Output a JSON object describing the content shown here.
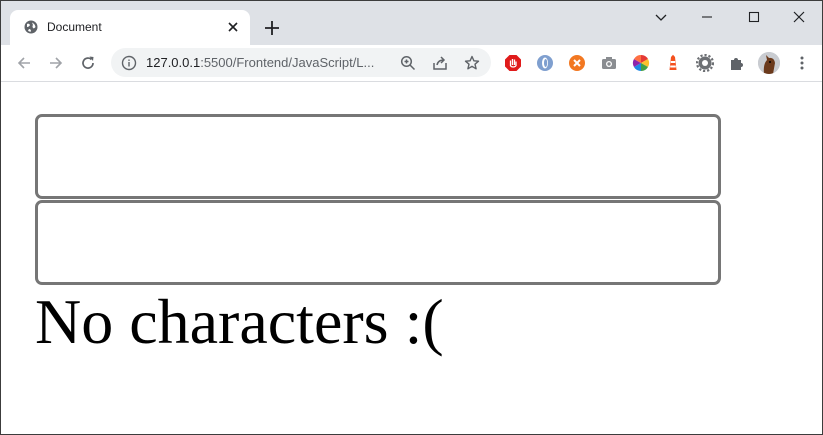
{
  "browser": {
    "tab": {
      "title": "Document",
      "favicon": "globe-icon",
      "close_icon": "close-icon"
    },
    "new_tab_icon": "plus-icon",
    "window_controls": [
      "chevron-down-icon",
      "minimize-icon",
      "maximize-icon",
      "close-icon"
    ],
    "toolbar": {
      "nav_icons": [
        "back-arrow-icon",
        "forward-arrow-icon",
        "reload-icon"
      ],
      "address": {
        "host": "127.0.0.1",
        "rest": ":5500/Frontend/JavaScript/L..."
      },
      "omnibox_icons": [
        "zoom-icon",
        "share-icon",
        "star-icon"
      ],
      "extensions": [
        "adblock-icon",
        "opera-icon",
        "orange-extension-icon",
        "camera-icon",
        "color-wheel-icon",
        "lighthouse-icon",
        "gear-extension-icon",
        "puzzle-icon"
      ],
      "profile": "avatar",
      "menu_icon": "kebab-menu-icon"
    }
  },
  "page": {
    "input_boxes": [
      "",
      ""
    ],
    "message": "No characters :("
  }
}
